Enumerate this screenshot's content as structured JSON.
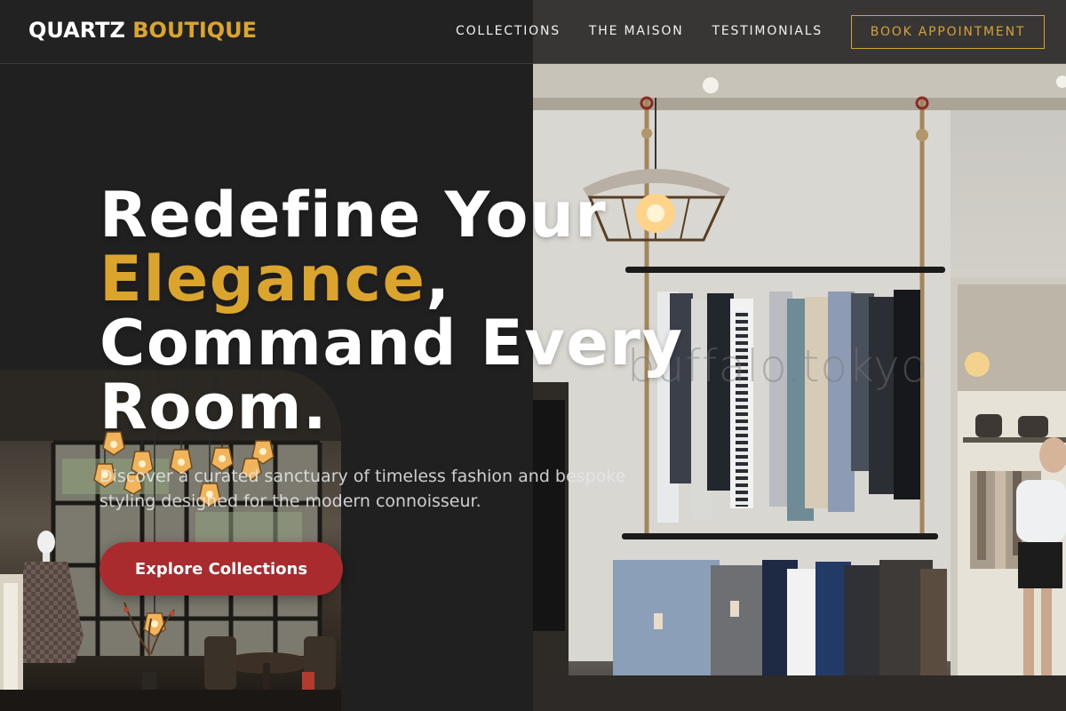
{
  "nav": {
    "brand_main": "QUARTZ",
    "brand_accent": "BOUTIQUE",
    "links": [
      "COLLECTIONS",
      "THE MAISON",
      "TESTIMONIALS"
    ],
    "cta": "BOOK APPOINTMENT"
  },
  "hero": {
    "title_line1": "Redefine Your",
    "title_accent": "Elegance",
    "title_comma": ",",
    "title_line3": "Command Every",
    "title_line4": "Room.",
    "subtitle": "Discover a curated sanctuary of timeless fashion and bespoke styling designed for the modern connoisseur.",
    "cta": "Explore Collections"
  },
  "photo": {
    "watermark": "buffalo.tokyo"
  },
  "colors": {
    "accent_gold": "#dba42d",
    "cta_red": "#a92b2e",
    "background": "#202020"
  }
}
